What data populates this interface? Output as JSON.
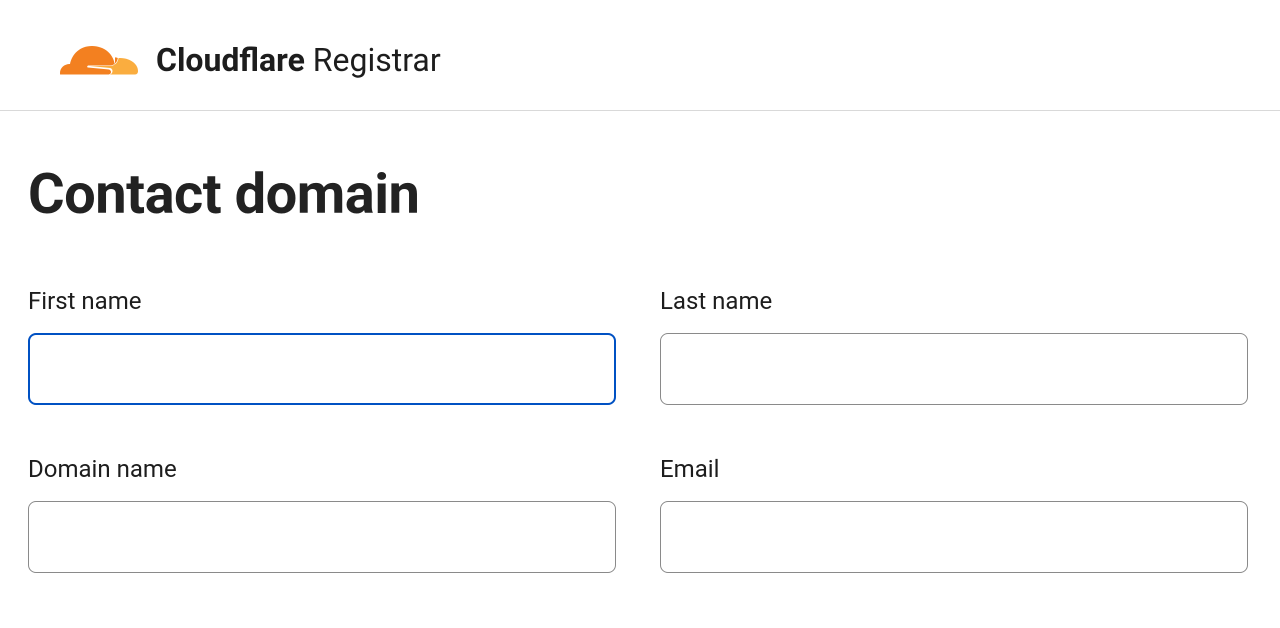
{
  "header": {
    "brand_bold": "Cloudflare",
    "brand_light": " Registrar"
  },
  "page": {
    "title": "Contact domain"
  },
  "form": {
    "first_name": {
      "label": "First name",
      "value": ""
    },
    "last_name": {
      "label": "Last name",
      "value": ""
    },
    "domain_name": {
      "label": "Domain name",
      "value": ""
    },
    "email": {
      "label": "Email",
      "value": ""
    }
  },
  "colors": {
    "brand_orange": "#f38020",
    "brand_orange_light": "#faad3f",
    "focus_blue": "#0051c3",
    "border_gray": "#8a8a8a"
  }
}
